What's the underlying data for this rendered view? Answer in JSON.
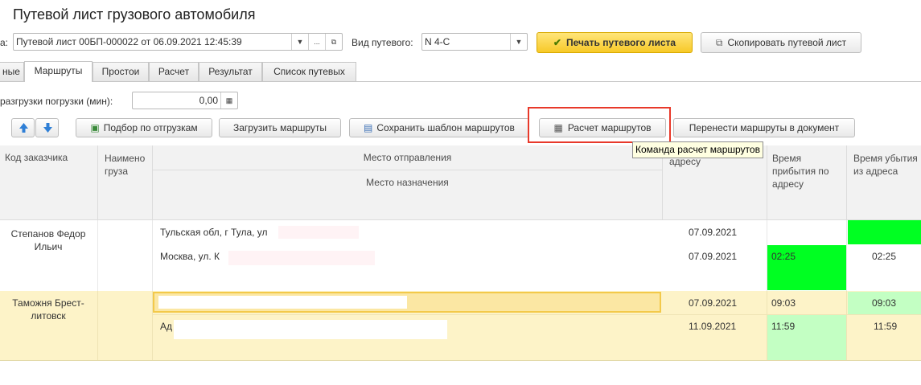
{
  "window": {
    "title": "Путевой лист грузового автомобиля"
  },
  "header": {
    "doc_label": "а:",
    "doc_value": "Путевой лист 00БП-000022 от 06.09.2021 12:45:39",
    "type_label": "Вид путевого:",
    "type_value": "N 4-С",
    "print_button": "Печать путевого листа",
    "copy_button": "Скопировать путевой лист"
  },
  "tabs": [
    {
      "label": "ные"
    },
    {
      "label": "Маршруты",
      "active": true
    },
    {
      "label": "Простои"
    },
    {
      "label": "Расчет"
    },
    {
      "label": "Результат"
    },
    {
      "label": "Список путевых"
    }
  ],
  "unload": {
    "label": "разгрузки погрузки (мин):",
    "value": "0,00"
  },
  "toolbar": {
    "select_shipments": "Подбор по отгрузкам",
    "load_routes": "Загрузить маршруты",
    "save_template": "Сохранить шаблон маршрутов",
    "calc_routes": "Расчет маршрутов",
    "move_routes": "Перенести маршруты в документ",
    "tooltip": "Команда расчет маршрутов"
  },
  "table": {
    "columns": {
      "customer": "Код заказчика",
      "cargo": "Наимено груза",
      "from": "Место отправления",
      "to": "Место назначения",
      "arr_date": "Дата прибытия по адресу",
      "arr_time": "Время прибытия по адресу",
      "dep_time": "Время убытия из адреса"
    },
    "rows": [
      {
        "customer": "Степанов Федор Ильич",
        "from": "Тульская обл, г Тула, ул",
        "to": "Москва, ул. К",
        "date1": "07.09.2021",
        "date2": "07.09.2021",
        "arr2": "02:25",
        "dep2": "02:25"
      },
      {
        "customer": "Таможня Брест-литовск",
        "from": "",
        "to": "Ад",
        "date1": "07.09.2021",
        "date2": "11.09.2021",
        "arr1": "09:03",
        "dep1": "09:03",
        "arr2": "11:59",
        "dep2": "11:59"
      }
    ]
  },
  "colors": {
    "accent_yellow": "#f7c928",
    "row_selected": "#fdf3c8",
    "green_strong": "#00ff22",
    "green_light": "#c3ffc3",
    "highlight_red": "#e8392a",
    "tooltip_bg": "#ffffe1"
  }
}
